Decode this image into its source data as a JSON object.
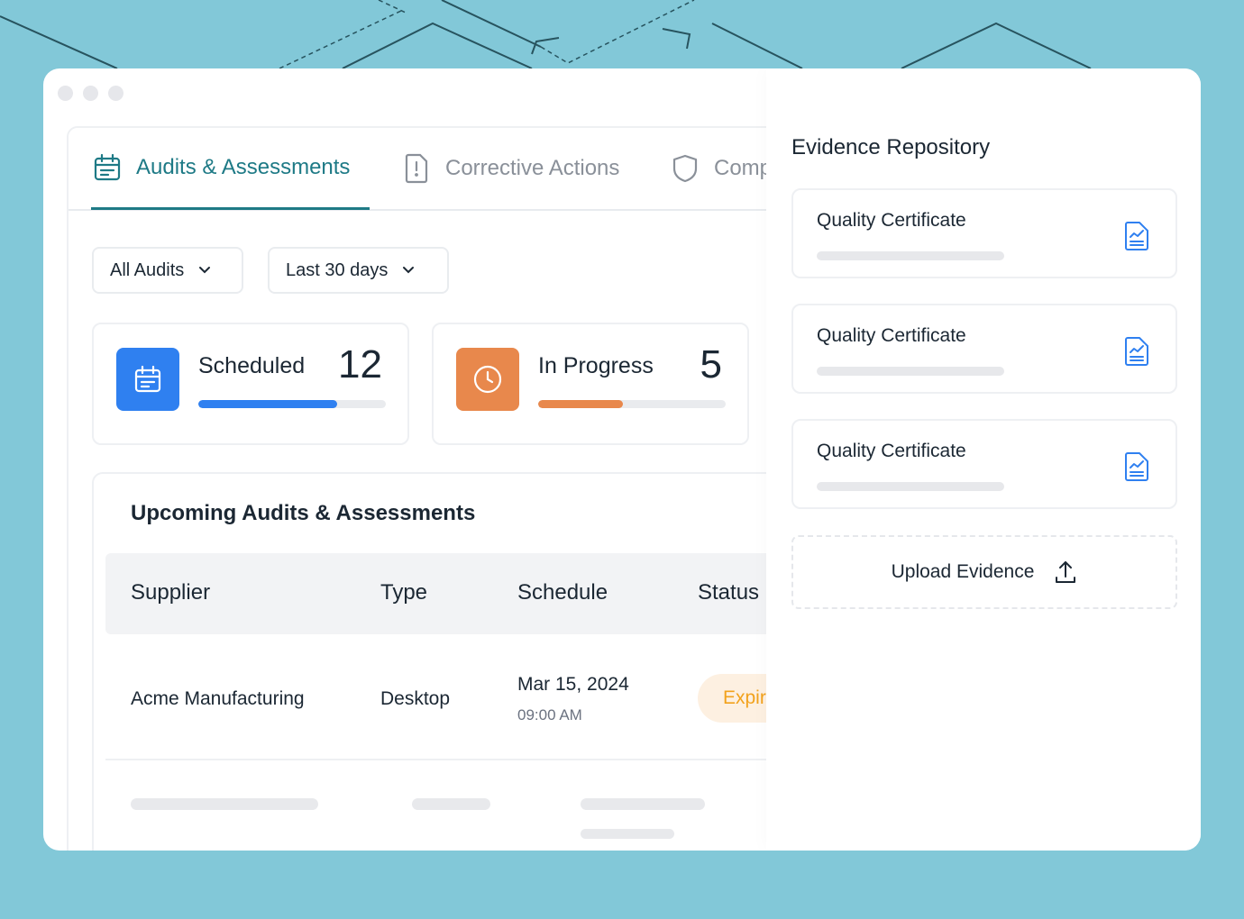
{
  "tabs": [
    {
      "label": "Audits & Assessments",
      "icon": "calendar-icon",
      "active": true
    },
    {
      "label": "Corrective Actions",
      "icon": "alert-document-icon",
      "active": false
    },
    {
      "label": "Comp",
      "icon": "shield-icon",
      "active": false
    }
  ],
  "filters": {
    "audits": "All Audits",
    "period": "Last 30 days"
  },
  "stats": {
    "scheduled": {
      "label": "Scheduled",
      "value": "12",
      "progress": 0.74,
      "color": "#2f80f0"
    },
    "in_progress": {
      "label": "In Progress",
      "value": "5",
      "progress": 0.45,
      "color": "#e8884c"
    }
  },
  "table": {
    "title": "Upcoming Audits & Assessments",
    "columns": [
      "Supplier",
      "Type",
      "Schedule",
      "Status"
    ],
    "rows": [
      {
        "supplier": "Acme Manufacturing",
        "type": "Desktop",
        "date": "Mar 15, 2024",
        "time": "09:00 AM",
        "status": "Expir"
      }
    ]
  },
  "evidence": {
    "title": "Evidence Repository",
    "items": [
      {
        "name": "Quality Certificate",
        "icon": "document-chart-icon"
      },
      {
        "name": "Quality Certificate",
        "icon": "document-chart-icon"
      },
      {
        "name": "Quality Certificate",
        "icon": "document-chart-icon"
      }
    ],
    "upload_label": "Upload Evidence"
  },
  "colors": {
    "accent": "#1e7a86",
    "background": "#82c8d8",
    "status_warning": "#f2a21c",
    "icon_blue": "#2f80f0"
  }
}
